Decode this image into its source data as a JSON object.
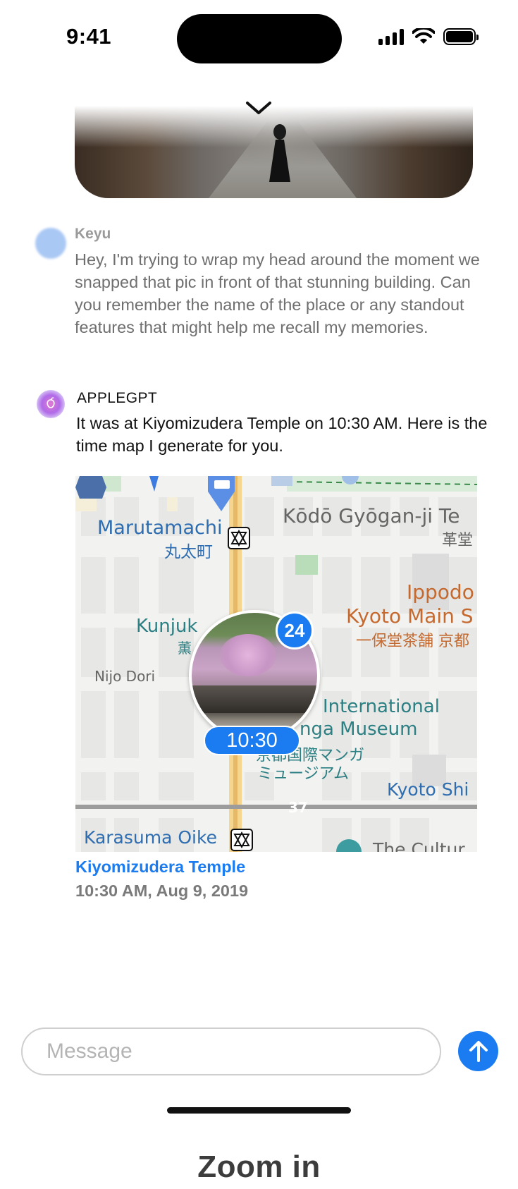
{
  "status_bar": {
    "time": "9:41"
  },
  "messages": [
    {
      "sender": "Keyu",
      "text": "Hey, I'm trying to wrap my head around the moment we snapped that pic in front of that stunning building. Can you remember the name of the place or any standout features that might help me recall my memories."
    },
    {
      "sender": "APPLEGPT",
      "text": "It was at Kiyomizudera Temple on 10:30 AM. Here is the time map I generate for you."
    }
  ],
  "map": {
    "labels": {
      "marutamachi_en": "Marutamachi",
      "marutamachi_jp": "丸太町",
      "kodo_en": "Kōdō Gyōgan-ji Te",
      "kodo_jp": "革堂",
      "ippodo": "Ippodo",
      "kyoto_main": "Kyoto Main S",
      "ippodo_jp": "一保堂茶舗 京都",
      "kunjuk": "Kunjuk",
      "kunjuk_jp": "薫",
      "nijo": "Nijo Dori",
      "intl": "International",
      "manga_museum": "nga Museum",
      "manga_jp_1": "京都国際マンガ",
      "manga_jp_2": "ミュージアム",
      "kyoto_shi": "Kyoto Shi",
      "karasuma": "Karasuma Oike",
      "culture": "The Cultur"
    },
    "photo_count": "24",
    "time_pill": "10:30",
    "route_number": "37"
  },
  "place": {
    "name": "Kiyomizudera Temple",
    "datetime": "10:30 AM, Aug 9, 2019"
  },
  "composer": {
    "placeholder": "Message"
  },
  "caption": "Zoom in",
  "colors": {
    "accent": "#1a7cf0",
    "secondary_text": "#6f6f6f"
  }
}
